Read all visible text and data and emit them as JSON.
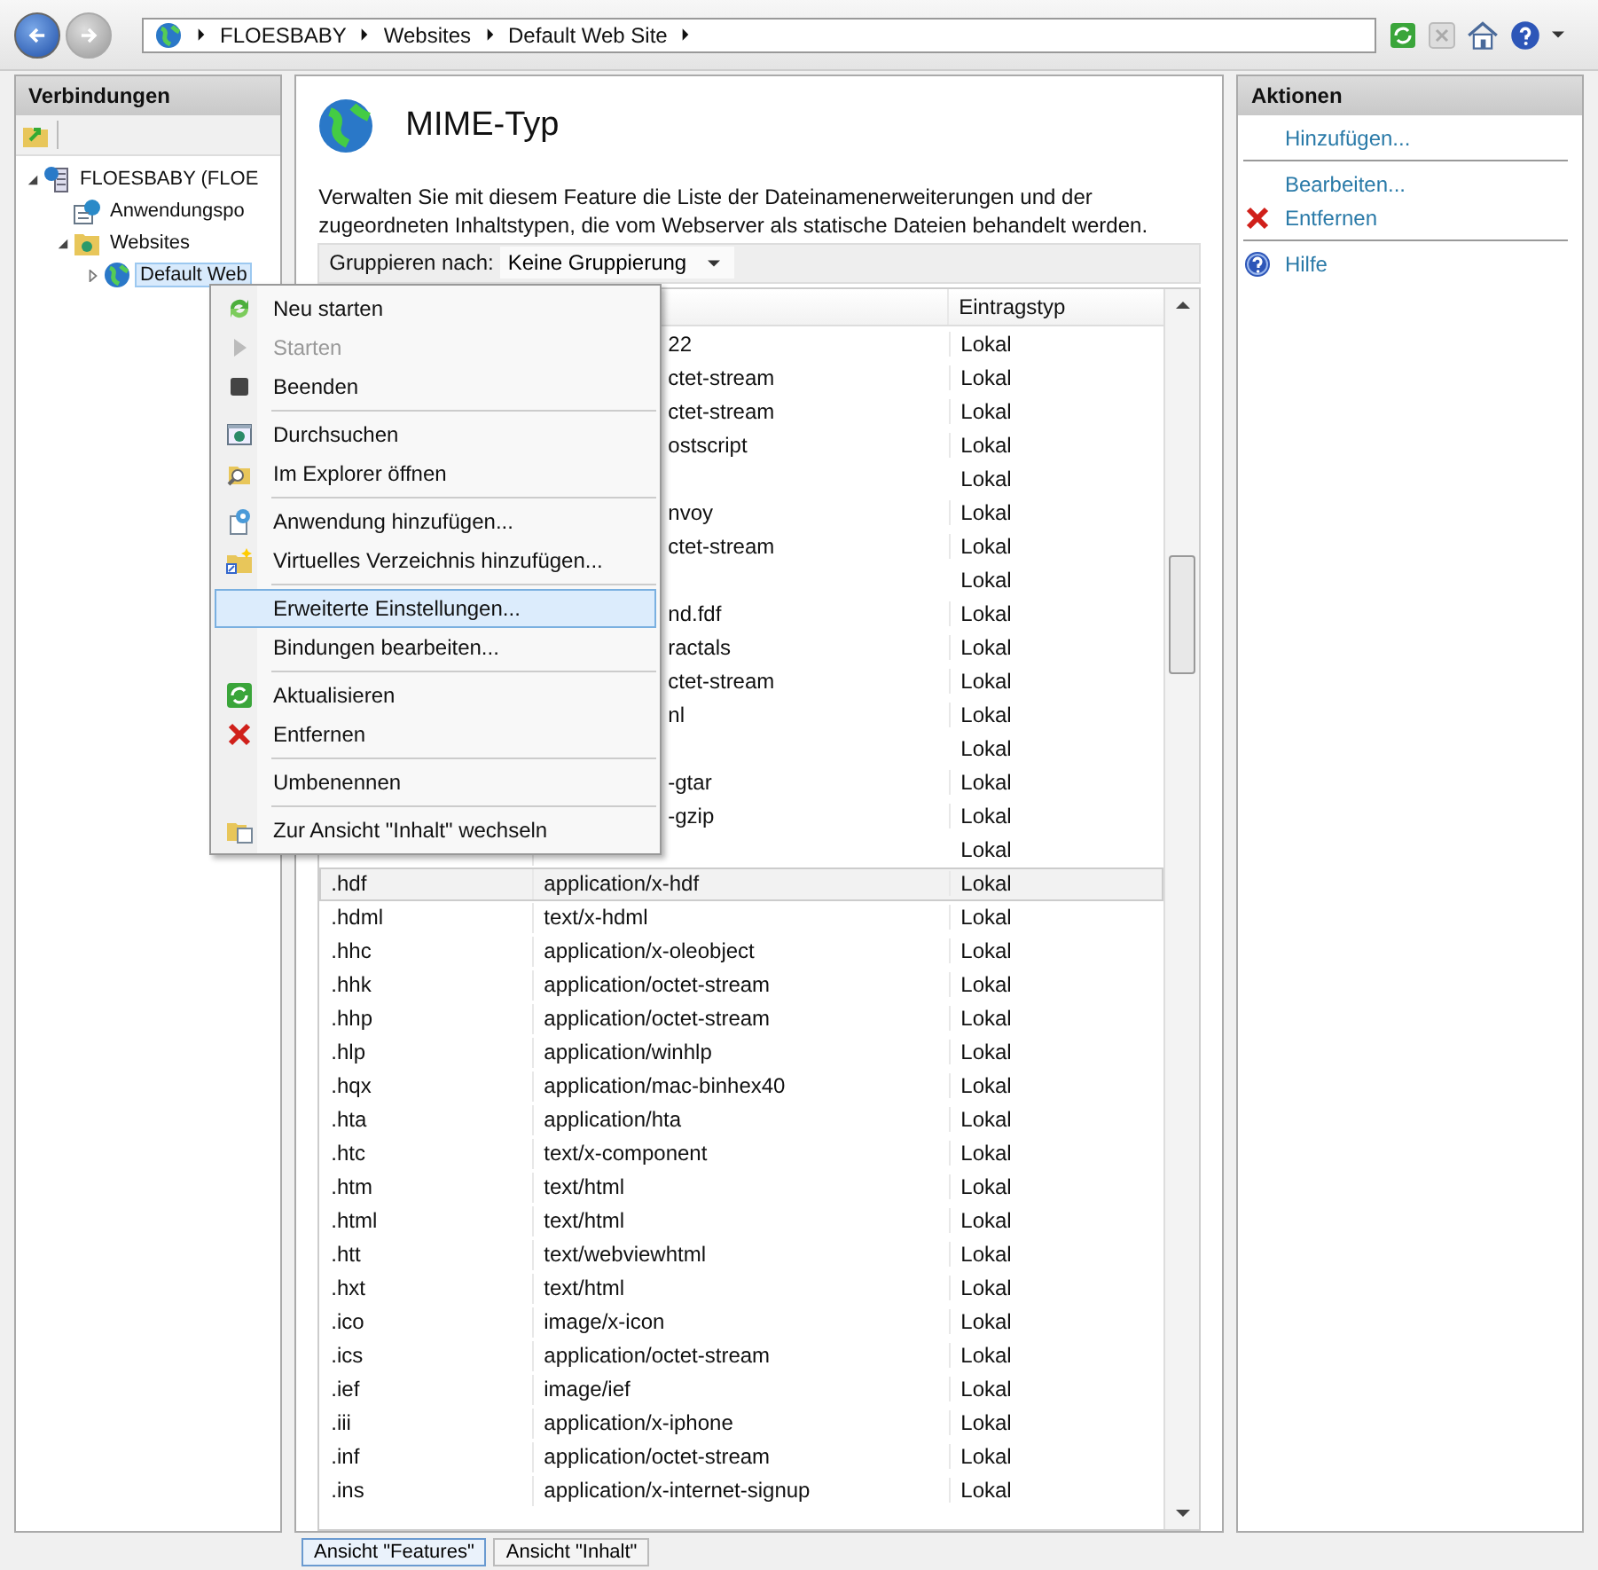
{
  "nav": {
    "breadcrumb": [
      "FLOESBABY",
      "Websites",
      "Default Web Site"
    ]
  },
  "connections": {
    "title": "Verbindungen",
    "tree": [
      {
        "label": "FLOESBABY (FLOE",
        "kind": "server",
        "expanded": true,
        "selected": false,
        "children": [
          {
            "label": "Anwendungspo",
            "kind": "pool",
            "selected": false
          },
          {
            "label": "Websites",
            "kind": "folder",
            "expanded": true,
            "selected": false,
            "children": [
              {
                "label": "Default Web",
                "kind": "site",
                "expanded": false,
                "selected": true
              }
            ]
          }
        ]
      }
    ]
  },
  "feature": {
    "title": "MIME-Typ",
    "description": "Verwalten Sie mit diesem Feature die Liste der Dateinamenerweiterungen und der zugeordneten Inhaltstypen, die vom Webserver als statische Dateien behandelt werden.",
    "group_by": {
      "label": "Gruppieren nach:",
      "value": "Keine Gruppierung"
    },
    "table": {
      "columns": [
        "Eintragstyp"
      ],
      "rows": [
        {
          "kind": "partial",
          "type": "22",
          "entry": "Lokal",
          "selected": false
        },
        {
          "kind": "partial",
          "type": "ctet-stream",
          "entry": "Lokal",
          "selected": false
        },
        {
          "kind": "partial",
          "type": "ctet-stream",
          "entry": "Lokal",
          "selected": false
        },
        {
          "kind": "partial",
          "type": "ostscript",
          "entry": "Lokal",
          "selected": false
        },
        {
          "kind": "partial",
          "entry": "Lokal",
          "selected": false
        },
        {
          "kind": "partial",
          "type": "nvoy",
          "entry": "Lokal",
          "selected": false
        },
        {
          "kind": "partial",
          "type": "ctet-stream",
          "entry": "Lokal",
          "selected": false
        },
        {
          "kind": "partial",
          "entry": "Lokal",
          "selected": false
        },
        {
          "kind": "partial",
          "type": "nd.fdf",
          "entry": "Lokal",
          "selected": false
        },
        {
          "kind": "partial",
          "type": "ractals",
          "entry": "Lokal",
          "selected": false
        },
        {
          "kind": "partial",
          "type": "ctet-stream",
          "entry": "Lokal",
          "selected": false
        },
        {
          "kind": "partial",
          "type": "nl",
          "entry": "Lokal",
          "selected": false
        },
        {
          "kind": "partial",
          "entry": "Lokal",
          "selected": false
        },
        {
          "kind": "partial",
          "type": "-gtar",
          "entry": "Lokal",
          "selected": false
        },
        {
          "kind": "partial",
          "type": "-gzip",
          "entry": "Lokal",
          "selected": false
        },
        {
          "kind": "partial",
          "entry": "Lokal",
          "selected": false
        },
        {
          "kind": "full",
          "ext": ".hdf",
          "type": "application/x-hdf",
          "entry": "Lokal",
          "selected": true
        },
        {
          "kind": "full",
          "ext": ".hdml",
          "type": "text/x-hdml",
          "entry": "Lokal",
          "selected": false
        },
        {
          "kind": "full",
          "ext": ".hhc",
          "type": "application/x-oleobject",
          "entry": "Lokal",
          "selected": false
        },
        {
          "kind": "full",
          "ext": ".hhk",
          "type": "application/octet-stream",
          "entry": "Lokal",
          "selected": false
        },
        {
          "kind": "full",
          "ext": ".hhp",
          "type": "application/octet-stream",
          "entry": "Lokal",
          "selected": false
        },
        {
          "kind": "full",
          "ext": ".hlp",
          "type": "application/winhlp",
          "entry": "Lokal",
          "selected": false
        },
        {
          "kind": "full",
          "ext": ".hqx",
          "type": "application/mac-binhex40",
          "entry": "Lokal",
          "selected": false
        },
        {
          "kind": "full",
          "ext": ".hta",
          "type": "application/hta",
          "entry": "Lokal",
          "selected": false
        },
        {
          "kind": "full",
          "ext": ".htc",
          "type": "text/x-component",
          "entry": "Lokal",
          "selected": false
        },
        {
          "kind": "full",
          "ext": ".htm",
          "type": "text/html",
          "entry": "Lokal",
          "selected": false
        },
        {
          "kind": "full",
          "ext": ".html",
          "type": "text/html",
          "entry": "Lokal",
          "selected": false
        },
        {
          "kind": "full",
          "ext": ".htt",
          "type": "text/webviewhtml",
          "entry": "Lokal",
          "selected": false
        },
        {
          "kind": "full",
          "ext": ".hxt",
          "type": "text/html",
          "entry": "Lokal",
          "selected": false
        },
        {
          "kind": "full",
          "ext": ".ico",
          "type": "image/x-icon",
          "entry": "Lokal",
          "selected": false
        },
        {
          "kind": "full",
          "ext": ".ics",
          "type": "application/octet-stream",
          "entry": "Lokal",
          "selected": false
        },
        {
          "kind": "full",
          "ext": ".ief",
          "type": "image/ief",
          "entry": "Lokal",
          "selected": false
        },
        {
          "kind": "full",
          "ext": ".iii",
          "type": "application/x-iphone",
          "entry": "Lokal",
          "selected": false
        },
        {
          "kind": "full",
          "ext": ".inf",
          "type": "application/octet-stream",
          "entry": "Lokal",
          "selected": false
        },
        {
          "kind": "full",
          "ext": ".ins",
          "type": "application/x-internet-signup",
          "entry": "Lokal",
          "selected": false
        }
      ]
    }
  },
  "view_tabs": [
    {
      "label": "Ansicht \"Features\"",
      "selected": true
    },
    {
      "label": "Ansicht \"Inhalt\"",
      "selected": false
    }
  ],
  "actions": {
    "title": "Aktionen",
    "groups": [
      [
        {
          "label": "Hinzufügen...",
          "kind": "plain"
        }
      ],
      [
        {
          "label": "Bearbeiten...",
          "kind": "plain"
        },
        {
          "label": "Entfernen",
          "kind": "remove"
        }
      ],
      [
        {
          "label": "Hilfe",
          "kind": "help"
        }
      ]
    ]
  },
  "context_menu": {
    "groups": [
      [
        {
          "label": "Neu starten",
          "kind": "restart",
          "disabled": false,
          "selected": false
        },
        {
          "label": "Starten",
          "kind": "play",
          "disabled": true,
          "selected": false
        },
        {
          "label": "Beenden",
          "kind": "stop",
          "disabled": false,
          "selected": false
        }
      ],
      [
        {
          "label": "Durchsuchen",
          "kind": "browse",
          "disabled": false,
          "selected": false
        },
        {
          "label": "Im Explorer öffnen",
          "kind": "explorer",
          "disabled": false,
          "selected": false
        }
      ],
      [
        {
          "label": "Anwendung hinzufügen...",
          "kind": "app",
          "disabled": false,
          "selected": false
        },
        {
          "label": "Virtuelles Verzeichnis hinzufügen...",
          "kind": "vdir",
          "disabled": false,
          "selected": false
        }
      ],
      [
        {
          "label": "Erweiterte Einstellungen...",
          "kind": "plain",
          "disabled": false,
          "selected": true
        },
        {
          "label": "Bindungen bearbeiten...",
          "kind": "plain",
          "disabled": false,
          "selected": false
        }
      ],
      [
        {
          "label": "Aktualisieren",
          "kind": "refresh",
          "disabled": false,
          "selected": false
        },
        {
          "label": "Entfernen",
          "kind": "remove",
          "disabled": false,
          "selected": false
        }
      ],
      [
        {
          "label": "Umbenennen",
          "kind": "plain",
          "disabled": false,
          "selected": false
        }
      ],
      [
        {
          "label": "Zur Ansicht \"Inhalt\" wechseln",
          "kind": "content",
          "disabled": false,
          "selected": false
        }
      ]
    ]
  }
}
